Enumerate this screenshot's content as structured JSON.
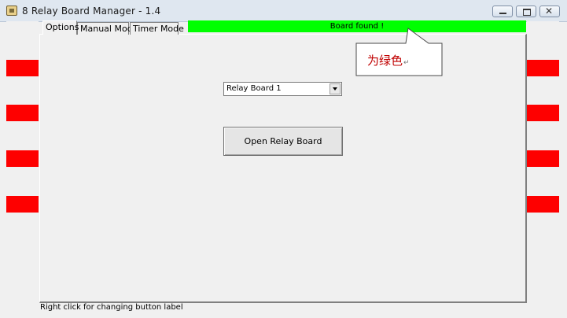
{
  "window": {
    "title": "8 Relay Board Manager  - 1.4",
    "controls": {
      "minimize": "▁",
      "maximize": "□",
      "close": "✕"
    }
  },
  "tabs": [
    {
      "label": "Options"
    },
    {
      "label": "Manual Mode"
    },
    {
      "label": "Timer Mode"
    }
  ],
  "status": {
    "text": "Board found !",
    "color": "#00ff00"
  },
  "callout": {
    "text": "为绿色",
    "mark": "↵"
  },
  "relay_indicator_color": "#fe0000",
  "board_select": {
    "value": "Relay Board 1"
  },
  "open_button": {
    "label": "Open Relay Board"
  },
  "footer": {
    "text": "Right click for changing button label"
  }
}
